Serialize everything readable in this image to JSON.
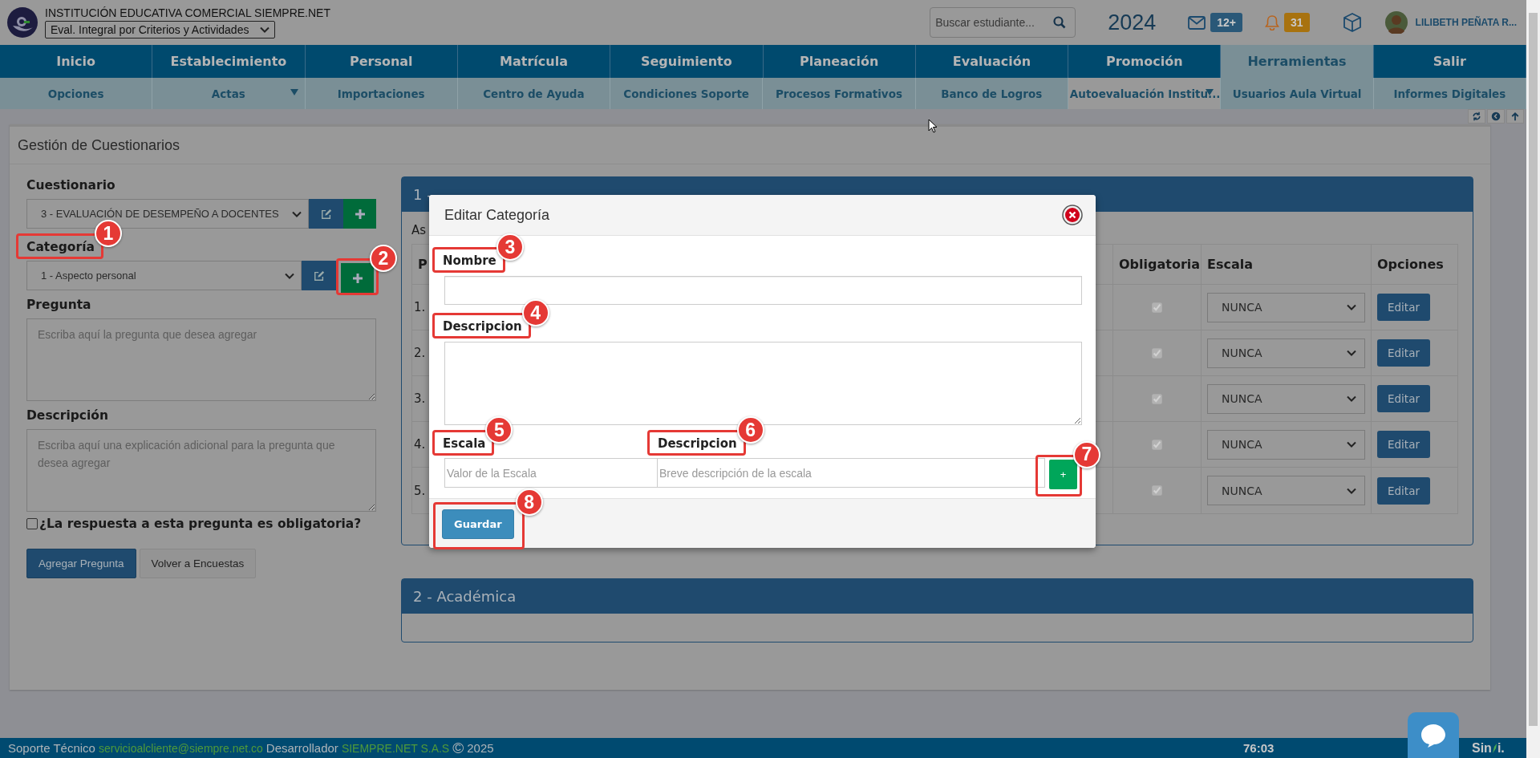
{
  "header": {
    "school": "INSTITUCIÓN EDUCATIVA COMERCIAL SIEMPRE.NET",
    "mode": "Eval. Integral por Criterios y Actividades",
    "search": {
      "placeholder": "Buscar estudiante..."
    },
    "year": "2024",
    "messages": "12+",
    "notifications": "31",
    "user": "LILIBETH PEÑATA R..."
  },
  "nav": [
    {
      "label": "Inicio",
      "selected": false
    },
    {
      "label": "Establecimiento",
      "selected": false
    },
    {
      "label": "Personal",
      "selected": false
    },
    {
      "label": "Matrícula",
      "selected": false
    },
    {
      "label": "Seguimiento",
      "selected": false
    },
    {
      "label": "Planeación",
      "selected": false
    },
    {
      "label": "Evaluación",
      "selected": false
    },
    {
      "label": "Promoción",
      "selected": false
    },
    {
      "label": "Herramientas",
      "selected": true
    },
    {
      "label": "Salir",
      "selected": false
    }
  ],
  "subnav": [
    {
      "label": "Opciones",
      "dropdown": false,
      "hovered": false
    },
    {
      "label": "Actas",
      "dropdown": true,
      "hovered": false
    },
    {
      "label": "Importaciones",
      "dropdown": false,
      "hovered": false
    },
    {
      "label": "Centro de Ayuda",
      "dropdown": false,
      "hovered": false
    },
    {
      "label": "Condiciones Soporte",
      "dropdown": false,
      "hovered": false
    },
    {
      "label": "Procesos Formativos",
      "dropdown": false,
      "hovered": false
    },
    {
      "label": "Banco de Logros",
      "dropdown": false,
      "hovered": false
    },
    {
      "label": "Autoevaluación Institu...",
      "dropdown": true,
      "hovered": true
    },
    {
      "label": "Usuarios Aula Virtual",
      "dropdown": false,
      "hovered": false
    },
    {
      "label": "Informes Digitales",
      "dropdown": false,
      "hovered": false
    }
  ],
  "page_title": "Gestión de Cuestionarios",
  "form": {
    "questionnaire": {
      "label": "Cuestionario",
      "value": "3 - EVALUACIÓN DE DESEMPEÑO A DOCENTES"
    },
    "category": {
      "label": "Categoría",
      "label_callout": "1",
      "value": "1 - Aspecto personal",
      "add_callout": "2"
    },
    "question": {
      "label": "Pregunta",
      "placeholder": "Escriba aquí la pregunta que desea agregar"
    },
    "description": {
      "label": "Descripción",
      "placeholder": "Escriba aquí una explicación adicional para la pregunta que desea agregar"
    },
    "required": {
      "label": "¿La respuesta a esta pregunta es obligatoria?",
      "checked": false
    },
    "buttons": [
      {
        "label": "Agregar Pregunta",
        "kind": "primary"
      },
      {
        "label": "Volver a Encuestas",
        "kind": "default"
      }
    ]
  },
  "panels": [
    {
      "title": "1 -",
      "intro": "As",
      "table": {
        "columns": [
          "P",
          "Obligatoria",
          "Escala",
          "Opciones"
        ],
        "rows": [
          {
            "number": "1.",
            "required": true,
            "scale": "NUNCA",
            "action": "Editar"
          },
          {
            "number": "2.",
            "required": true,
            "scale": "NUNCA",
            "action": "Editar"
          },
          {
            "number": "3.",
            "required": true,
            "scale": "NUNCA",
            "action": "Editar"
          },
          {
            "number": "4.",
            "required": true,
            "scale": "NUNCA",
            "action": "Editar"
          },
          {
            "number": "5.",
            "required": true,
            "scale": "NUNCA",
            "action": "Editar"
          }
        ]
      }
    },
    {
      "title": "2 - Académica"
    }
  ],
  "modal": {
    "title": "Editar Categoría",
    "name": {
      "label": "Nombre",
      "callout": "3"
    },
    "description": {
      "label": "Descripcion",
      "callout": "4"
    },
    "scale": {
      "label": "Escala",
      "callout": "5",
      "placeholder": "Valor de la Escala"
    },
    "scale_description": {
      "label": "Descripcion",
      "callout": "6",
      "placeholder": "Breve descripción de la escala"
    },
    "add": {
      "label": "+",
      "callout": "7"
    },
    "save": {
      "label": "Guardar",
      "callout": "8"
    }
  },
  "footer": {
    "support_label": "Soporte Técnico",
    "support_email": "servicioalcliente@siempre.net.co",
    "developer_label": "Desarrollador",
    "developer": "SIEMPRE.NET S.A.S",
    "copyright": "©",
    "year": "2025",
    "timer": "76:03",
    "brand_start": "Sin",
    "brand_end": "i."
  }
}
